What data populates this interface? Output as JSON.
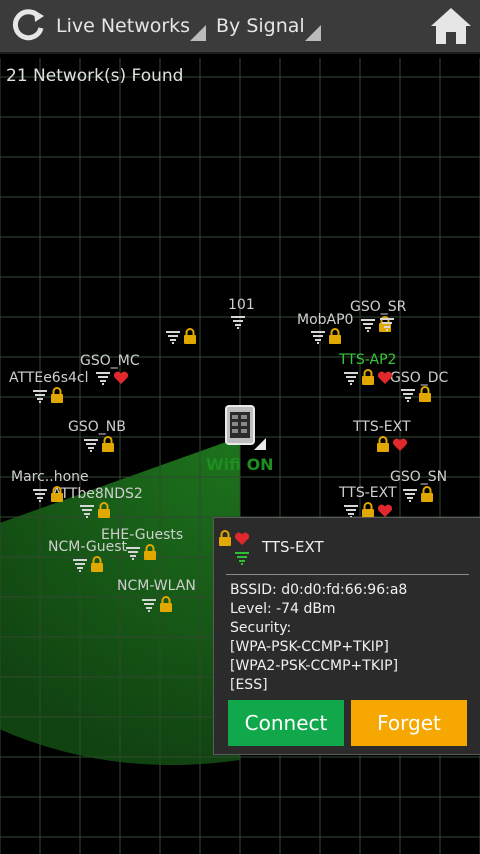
{
  "header": {
    "live_networks": "Live Networks",
    "sort": "By Signal"
  },
  "status": {
    "count_text": "21 Network(s) Found"
  },
  "center": {
    "wifi_status": "Wifi ON"
  },
  "networks": [
    {
      "label": "101",
      "color": "#cfcfcf"
    },
    {
      "label": "GSO_SR",
      "color": "#cfcfcf"
    },
    {
      "label": "MobAP0",
      "color": "#cfcfcf"
    },
    {
      "label": "TTS-AP2",
      "color": "#39c83b"
    },
    {
      "label": "GSO_MC",
      "color": "#cfcfcf"
    },
    {
      "label": "ATTEe6s4cl",
      "color": "#cfcfcf"
    },
    {
      "label": "GSO_DC",
      "color": "#cfcfcf"
    },
    {
      "label": "GSO_NB",
      "color": "#cfcfcf"
    },
    {
      "label": "TTS-EXT",
      "color": "#cfcfcf"
    },
    {
      "label": "Marc..hone",
      "color": "#cfcfcf"
    },
    {
      "label": "ATTbe8NDS2",
      "color": "#cfcfcf"
    },
    {
      "label": "GSO_SN",
      "color": "#cfcfcf"
    },
    {
      "label": "TTS-EXT",
      "color": "#cfcfcf"
    },
    {
      "label": "EHE-Guests",
      "color": "#cfcfcf"
    },
    {
      "label": "NCM-Guest",
      "color": "#cfcfcf"
    },
    {
      "label": "NCM-WLAN",
      "color": "#cfcfcf"
    }
  ],
  "popup": {
    "ssid": "TTS-EXT",
    "bssid": "BSSID: d0:d0:fd:66:96:a8",
    "level": "Level: -74 dBm",
    "security_label": "Security:",
    "security_1": "[WPA-PSK-CCMP+TKIP]",
    "security_2": "[WPA2-PSK-CCMP+TKIP]",
    "security_3": "[ESS]",
    "connect_label": "Connect",
    "forget_label": "Forget",
    "connect_color": "#10a84a",
    "forget_color": "#f6a800"
  },
  "colors": {
    "grid": "#2f4a2f",
    "sweep": "#1f7a1f",
    "lock": "#e0a800",
    "heart": "#e0282d"
  }
}
